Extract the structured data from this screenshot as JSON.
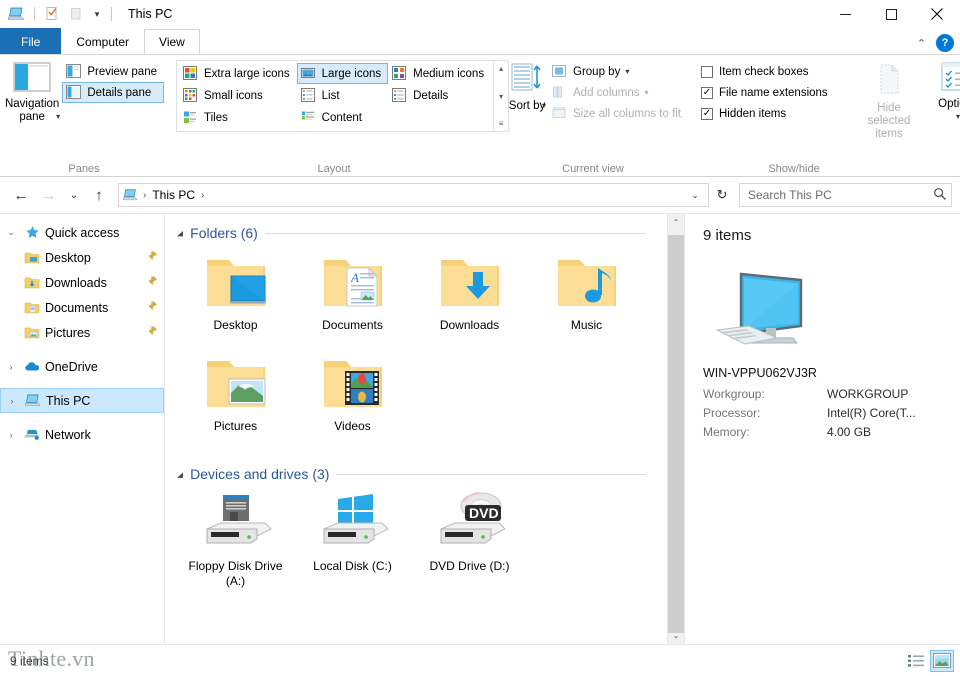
{
  "window": {
    "title": "This PC",
    "icons": {
      "app": "this-pc-icon",
      "properties": "properties-icon",
      "new_folder": "new-folder-icon",
      "customize": "customize-quick-access-icon"
    },
    "controls": {
      "minimize": "−",
      "maximize": "☐",
      "close": "✕"
    }
  },
  "tabs": [
    {
      "label": "File",
      "active": false,
      "kind": "file"
    },
    {
      "label": "Computer",
      "active": false,
      "kind": "normal"
    },
    {
      "label": "View",
      "active": true,
      "kind": "normal"
    }
  ],
  "tab_extras": {
    "collapse_ribbon": "⌃",
    "help": "?"
  },
  "ribbon": {
    "groups": [
      {
        "label": "Panes",
        "big_buttons": [
          {
            "label": "Navigation pane",
            "has_dropdown": true,
            "icon": "navigation-pane-icon"
          }
        ],
        "small_buttons": [
          {
            "label": "Preview pane",
            "state": "normal",
            "icon": "preview-pane-icon"
          },
          {
            "label": "Details pane",
            "state": "checked",
            "icon": "details-pane-icon"
          }
        ]
      },
      {
        "label": "Layout",
        "views": [
          {
            "label": "Extra large icons",
            "selected": false
          },
          {
            "label": "Small icons",
            "selected": false
          },
          {
            "label": "Tiles",
            "selected": false
          },
          {
            "label": "Large icons",
            "selected": true
          },
          {
            "label": "List",
            "selected": false
          },
          {
            "label": "Content",
            "selected": false
          },
          {
            "label": "Medium icons",
            "selected": false
          },
          {
            "label": "Details",
            "selected": false
          }
        ],
        "spinner": {
          "up": "▴",
          "down": "▾",
          "more": "≡"
        }
      },
      {
        "label": "Current view",
        "big_buttons": [
          {
            "label": "Sort by",
            "has_dropdown": true,
            "icon": "sort-by-icon"
          }
        ],
        "small_buttons": [
          {
            "label": "Group by",
            "state": "dropdown",
            "icon": "group-by-icon"
          },
          {
            "label": "Add columns",
            "state": "disabled-dropdown",
            "icon": "add-columns-icon"
          },
          {
            "label": "Size all columns to fit",
            "state": "disabled",
            "icon": "size-columns-icon"
          }
        ]
      },
      {
        "label": "Show/hide",
        "checkboxes": [
          {
            "label": "Item check boxes",
            "checked": false
          },
          {
            "label": "File name extensions",
            "checked": true
          },
          {
            "label": "Hidden items",
            "checked": true
          }
        ],
        "big_buttons": [
          {
            "label": "Hide selected items",
            "disabled": true,
            "icon": "hide-selected-items-icon"
          },
          {
            "label": "Options",
            "has_dropdown": true,
            "icon": "options-icon"
          }
        ]
      }
    ]
  },
  "address_bar": {
    "back": "←",
    "forward": "→",
    "recent": "⌄",
    "up": "↑",
    "crumbs": [
      "This PC"
    ],
    "separator": "›",
    "dropdown": "⌄",
    "refresh": "↻",
    "search_placeholder": "Search This PC",
    "search_value": "",
    "search_icon": "search-icon"
  },
  "nav_pane": {
    "items": [
      {
        "label": "Quick access",
        "icon": "star-icon",
        "expander": "⌄",
        "expanded": true,
        "indent": 0,
        "pinned": false,
        "selected": false
      },
      {
        "label": "Desktop",
        "icon": "desktop-folder-icon",
        "expander": "",
        "indent": 1,
        "pinned": true,
        "selected": false
      },
      {
        "label": "Downloads",
        "icon": "downloads-folder-icon",
        "expander": "",
        "indent": 1,
        "pinned": true,
        "selected": false
      },
      {
        "label": "Documents",
        "icon": "documents-folder-icon",
        "expander": "",
        "indent": 1,
        "pinned": true,
        "selected": false
      },
      {
        "label": "Pictures",
        "icon": "pictures-folder-icon",
        "expander": "",
        "indent": 1,
        "pinned": true,
        "selected": false
      },
      {
        "label": "OneDrive",
        "icon": "onedrive-icon",
        "expander": "›",
        "indent": 0,
        "pinned": false,
        "selected": false
      },
      {
        "label": "This PC",
        "icon": "this-pc-icon",
        "expander": "›",
        "indent": 0,
        "pinned": false,
        "selected": true
      },
      {
        "label": "Network",
        "icon": "network-icon",
        "expander": "›",
        "indent": 0,
        "pinned": false,
        "selected": false
      }
    ],
    "pin_glyph": "📌"
  },
  "content": {
    "groups": [
      {
        "title": "Folders (6)",
        "collapse_glyph": "◢",
        "items": [
          {
            "label": "Desktop",
            "icon": "desktop-folder-icon"
          },
          {
            "label": "Documents",
            "icon": "documents-folder-icon"
          },
          {
            "label": "Downloads",
            "icon": "downloads-folder-icon"
          },
          {
            "label": "Music",
            "icon": "music-folder-icon"
          },
          {
            "label": "Pictures",
            "icon": "pictures-folder-icon"
          },
          {
            "label": "Videos",
            "icon": "videos-folder-icon"
          }
        ]
      },
      {
        "title": "Devices and drives (3)",
        "collapse_glyph": "◢",
        "items": [
          {
            "label": "Floppy Disk Drive (A:)",
            "icon": "floppy-drive-icon"
          },
          {
            "label": "Local Disk (C:)",
            "icon": "local-disk-icon"
          },
          {
            "label": "DVD Drive (D:)",
            "icon": "dvd-drive-icon"
          }
        ]
      }
    ],
    "scrollbar": {
      "up": "⌃",
      "down": "⌄"
    }
  },
  "details_pane": {
    "items_count": "9 items",
    "computer_icon": "computer-monitor-icon",
    "computer_name": "WIN-VPPU062VJ3R",
    "properties": [
      {
        "label": "Workgroup:",
        "value": "WORKGROUP"
      },
      {
        "label": "Processor:",
        "value": "Intel(R) Core(T..."
      },
      {
        "label": "Memory:",
        "value": "4.00 GB"
      }
    ]
  },
  "status_bar": {
    "text": "9 items",
    "views": [
      {
        "name": "details-view-button",
        "active": false
      },
      {
        "name": "large-icons-view-button",
        "active": true
      }
    ]
  },
  "watermark": "Tinhte.vn",
  "colors": {
    "accent": "#0078d7",
    "file_tab": "#1a6fb5",
    "group_header": "#2b579a",
    "selection": "#cce8ff",
    "folder": "#f8d679"
  }
}
